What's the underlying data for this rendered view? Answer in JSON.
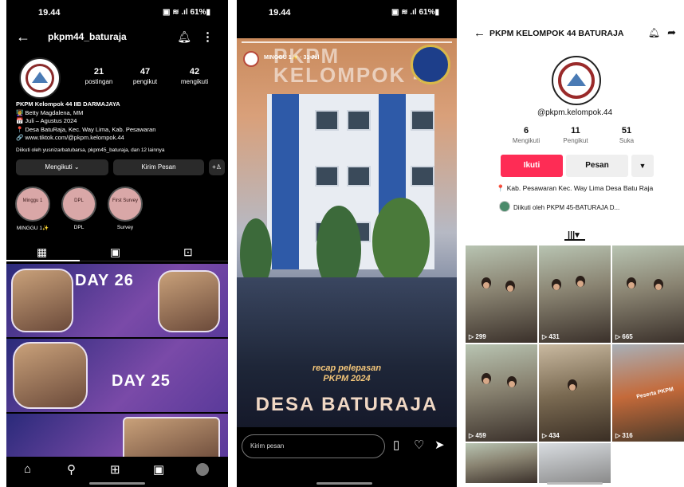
{
  "panel1": {
    "status": {
      "time": "19.44",
      "battery": "61%"
    },
    "header": {
      "username": "pkpm44_baturaja"
    },
    "stats": [
      {
        "value": "21",
        "label": "postingan"
      },
      {
        "value": "47",
        "label": "pengikut"
      },
      {
        "value": "42",
        "label": "mengikuti"
      }
    ],
    "bio": {
      "name": "PKPM Kelompok 44 IIB DARMAJAYA",
      "line1": "👩‍🏫 Betty Magdalena, MM",
      "line2": "📅 Juli – Agustus 2024",
      "line3": "📍 Desa BatuRaja, Kec. Way Lima, Kab. Pesawaran",
      "link": "🔗 www.tiktok.com/@pkpm.kelompok.44",
      "followed_by": "Diikuti oleh yusnizarbatubarsa, pkpm45_baturaja, dan 12 lainnya"
    },
    "buttons": {
      "following": "Mengikuti ⌄",
      "message": "Kirim Pesan",
      "add_person": "+♙"
    },
    "highlights": [
      {
        "cover": "Minggu 1",
        "label": "MINGGU 1✨"
      },
      {
        "cover": "DPL",
        "label": "DPL"
      },
      {
        "cover": "First Survey",
        "label": "Survey"
      }
    ],
    "grid_texts": {
      "day26": "DAY 26",
      "day25": "DAY 25"
    }
  },
  "panel2": {
    "status": {
      "time": "19.44",
      "battery": "61%"
    },
    "story": {
      "author": "MINGGU 1✨ · 31 Jul",
      "big_title": "PKPM KELOMPOK 44",
      "recap_line1": "recap pelepasan",
      "recap_line2": "PKPM 2024",
      "place": "DESA BATURAJA"
    },
    "reply_placeholder": "Kirim pesan"
  },
  "panel3": {
    "header": {
      "title": "PKPM KELOMPOK 44 BATURAJA"
    },
    "handle": "@pkpm.kelompok.44",
    "stats": [
      {
        "value": "6",
        "label": "Mengikuti"
      },
      {
        "value": "11",
        "label": "Pengikut"
      },
      {
        "value": "51",
        "label": "Suka"
      }
    ],
    "buttons": {
      "follow": "Ikuti",
      "message": "Pesan",
      "more": "▼"
    },
    "location": "📍 Kab. Pesawaran Kec. Way Lima Desa Batu Raja",
    "followed_by": "Diikuti oleh PKPM 45-BATURAJA D...",
    "grid_tab": "|||▾",
    "videos": [
      {
        "views": "▷ 299"
      },
      {
        "views": "▷ 431"
      },
      {
        "views": "▷ 665"
      },
      {
        "views": "▷ 459"
      },
      {
        "views": "▷ 434"
      },
      {
        "views": "▷ 316"
      }
    ],
    "overlay_text": "Peserta PKPM"
  }
}
